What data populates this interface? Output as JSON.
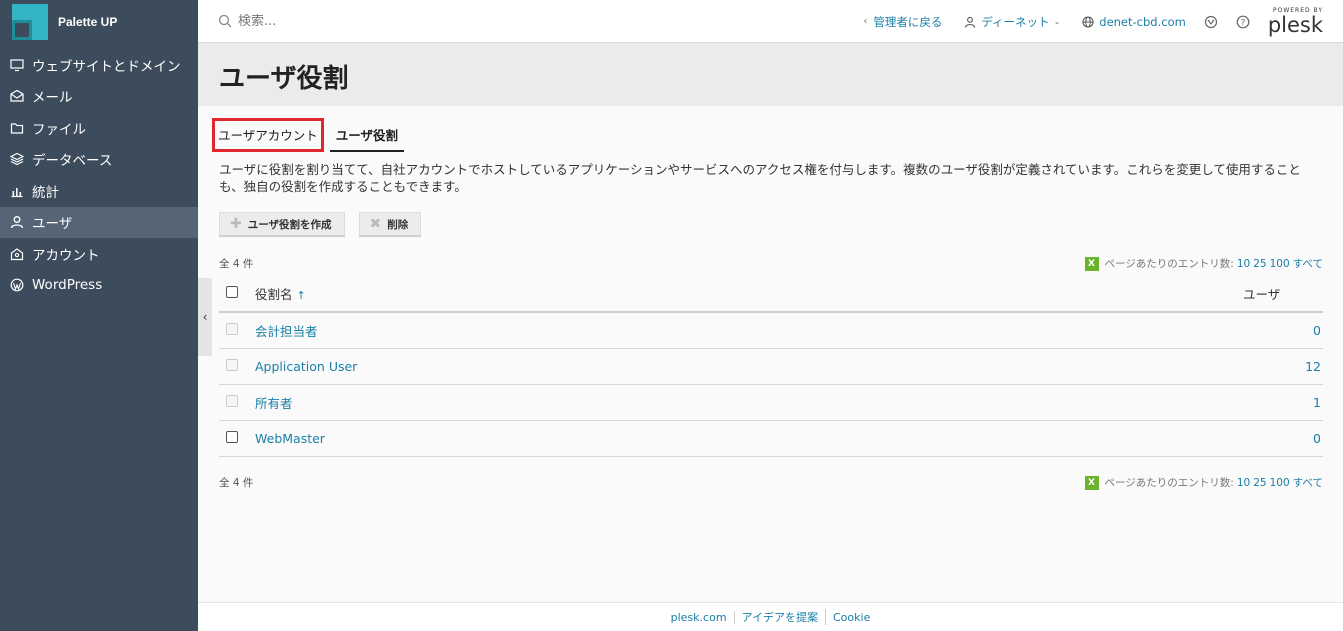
{
  "brand": {
    "name": "Palette UP"
  },
  "sidebar": {
    "items": [
      {
        "label": "ウェブサイトとドメイン",
        "icon": "monitor-icon"
      },
      {
        "label": "メール",
        "icon": "mail-icon"
      },
      {
        "label": "ファイル",
        "icon": "folder-icon"
      },
      {
        "label": "データベース",
        "icon": "database-icon"
      },
      {
        "label": "統計",
        "icon": "bar-chart-icon"
      },
      {
        "label": "ユーザ",
        "icon": "user-icon",
        "active": true
      },
      {
        "label": "アカウント",
        "icon": "account-icon"
      },
      {
        "label": "WordPress",
        "icon": "wordpress-icon"
      }
    ],
    "collapse_glyph": "‹"
  },
  "header": {
    "search_placeholder": "検索...",
    "back_glyph": "‹",
    "back_label": "管理者に戻る",
    "user_label": "ディーネット",
    "domain_label": "denet-cbd.com",
    "powered_by": "POWERED BY",
    "plesk": "plesk"
  },
  "page": {
    "title": "ユーザ役割"
  },
  "tabs": [
    {
      "label": "ユーザアカウント"
    },
    {
      "label": "ユーザ役割"
    }
  ],
  "description": "ユーザに役割を割り当てて、自社アカウントでホストしているアプリケーションやサービスへのアクセス権を付与します。複数のユーザ役割が定義されています。これらを変更して使用することも、独自の役割を作成することもできます。",
  "toolbar": {
    "create_label": "ユーザ役割を作成",
    "delete_label": "削除"
  },
  "list": {
    "total_text": "全 4 件",
    "per_page_label": "ページあたりのエントリ数:",
    "per_page_options": [
      "10",
      "25",
      "100",
      "すべて"
    ],
    "columns": {
      "name": "役割名",
      "users": "ユーザ"
    },
    "sort_glyph": "↑",
    "rows": [
      {
        "name": "会計担当者",
        "users": "0",
        "disabled": true
      },
      {
        "name": "Application User",
        "users": "12",
        "disabled": true
      },
      {
        "name": "所有者",
        "users": "1",
        "disabled": true
      },
      {
        "name": "WebMaster",
        "users": "0",
        "disabled": false
      }
    ]
  },
  "footer": {
    "links": [
      "plesk.com",
      "アイデアを提案",
      "Cookie"
    ]
  },
  "colors": {
    "sidebar_bg": "#3d4c5c",
    "sidebar_active": "#556576",
    "link": "#1a7fa6",
    "highlight_border": "#e0262e",
    "excel_green": "#6ab42d"
  }
}
